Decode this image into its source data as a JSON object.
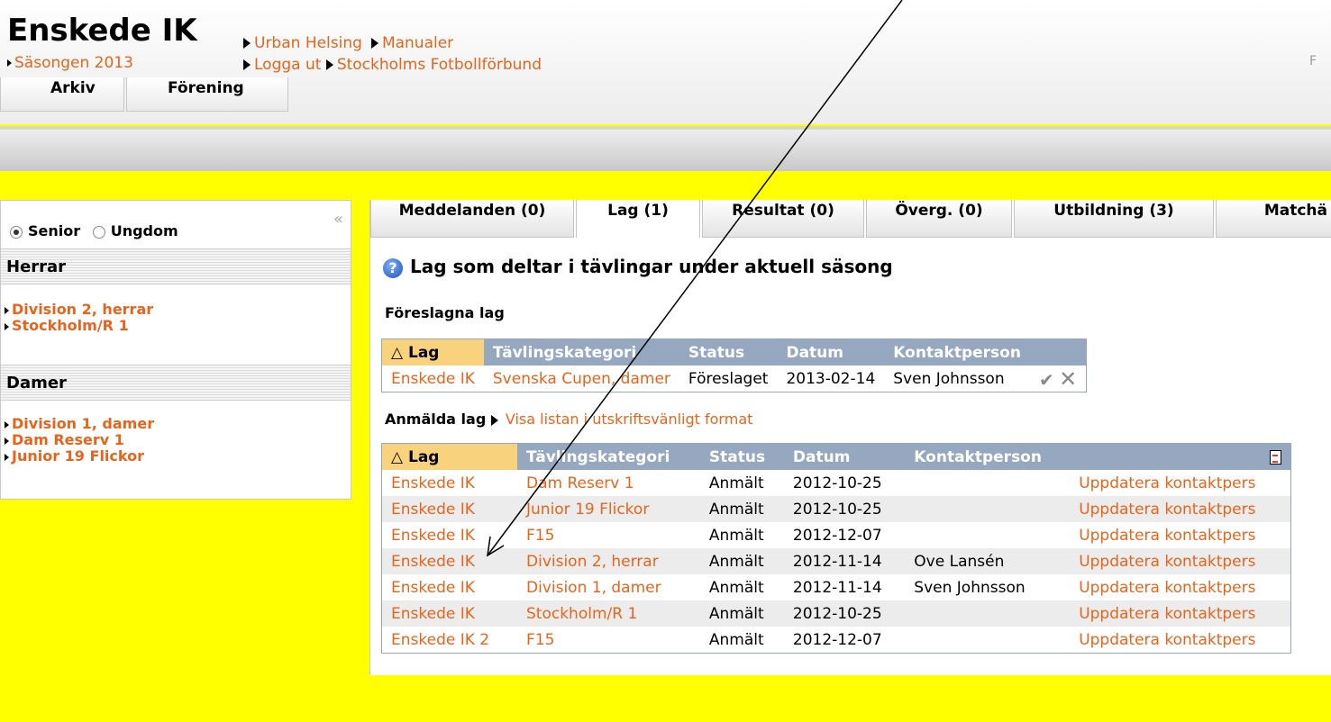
{
  "header": {
    "club_name": "Enskede IK",
    "season_link": "Säsongen 2013",
    "user_link": "Urban Helsing",
    "manuals_link": "Manualer",
    "logout_link": "Logga ut",
    "federation_link": "Stockholms Fotbollförbund",
    "right_fragment": "F",
    "tabs": [
      {
        "label": "Arkiv"
      },
      {
        "label": "Förening"
      }
    ]
  },
  "sidebar": {
    "collapse_glyph": "«",
    "radio_senior": "Senior",
    "radio_ungdom": "Ungdom",
    "sections": [
      {
        "title": "Herrar",
        "links": [
          "Division 2, herrar",
          "Stockholm/R 1"
        ]
      },
      {
        "title": "Damer",
        "links": [
          "Division 1, damer",
          "Dam Reserv 1",
          "Junior 19 Flickor"
        ]
      }
    ]
  },
  "content": {
    "tabs": [
      {
        "label": "Meddelanden (0)"
      },
      {
        "label": "Lag (1)"
      },
      {
        "label": "Resultat (0)"
      },
      {
        "label": "Överg. (0)"
      },
      {
        "label": "Utbildning (3)"
      },
      {
        "label": "Matchä"
      }
    ],
    "heading": "Lag som deltar i tävlingar under aktuell säsong",
    "proposed_title": "Föreslagna lag",
    "proposed_table": {
      "headers": [
        "Lag",
        "Tävlingskategori",
        "Status",
        "Datum",
        "Kontaktperson"
      ],
      "row": {
        "lag": "Enskede IK",
        "kategori": "Svenska Cupen, damer",
        "status": "Föreslaget",
        "datum": "2013-02-14",
        "kontakt": "Sven Johnsson"
      }
    },
    "registered_title": "Anmälda lag",
    "print_link": "Visa listan i utskriftsvänligt format",
    "registered_table": {
      "headers": [
        "Lag",
        "Tävlingskategori",
        "Status",
        "Datum",
        "Kontaktperson"
      ],
      "rows": [
        {
          "lag": "Enskede IK",
          "kategori": "Dam Reserv 1",
          "status": "Anmält",
          "datum": "2012-10-25",
          "kontakt": "",
          "action": "Uppdatera kontaktpers"
        },
        {
          "lag": "Enskede IK",
          "kategori": "Junior 19 Flickor",
          "status": "Anmält",
          "datum": "2012-10-25",
          "kontakt": "",
          "action": "Uppdatera kontaktpers"
        },
        {
          "lag": "Enskede IK",
          "kategori": "F15",
          "status": "Anmält",
          "datum": "2012-12-07",
          "kontakt": "",
          "action": "Uppdatera kontaktpers"
        },
        {
          "lag": "Enskede IK",
          "kategori": "Division 2, herrar",
          "status": "Anmält",
          "datum": "2012-11-14",
          "kontakt": "Ove Lansén",
          "action": "Uppdatera kontaktpers"
        },
        {
          "lag": "Enskede IK",
          "kategori": "Division 1, damer",
          "status": "Anmält",
          "datum": "2012-11-14",
          "kontakt": "Sven Johnsson",
          "action": "Uppdatera kontaktpers"
        },
        {
          "lag": "Enskede IK",
          "kategori": "Stockholm/R 1",
          "status": "Anmält",
          "datum": "2012-10-25",
          "kontakt": "",
          "action": "Uppdatera kontaktpers"
        },
        {
          "lag": "Enskede IK 2",
          "kategori": "F15",
          "status": "Anmält",
          "datum": "2012-12-07",
          "kontakt": "",
          "action": "Uppdatera kontaktpers"
        }
      ]
    }
  },
  "colors": {
    "link": "#e8641b",
    "page_bg": "#ffff00",
    "table_header": "#95a8bf",
    "sorted_header": "#f8d27c"
  }
}
